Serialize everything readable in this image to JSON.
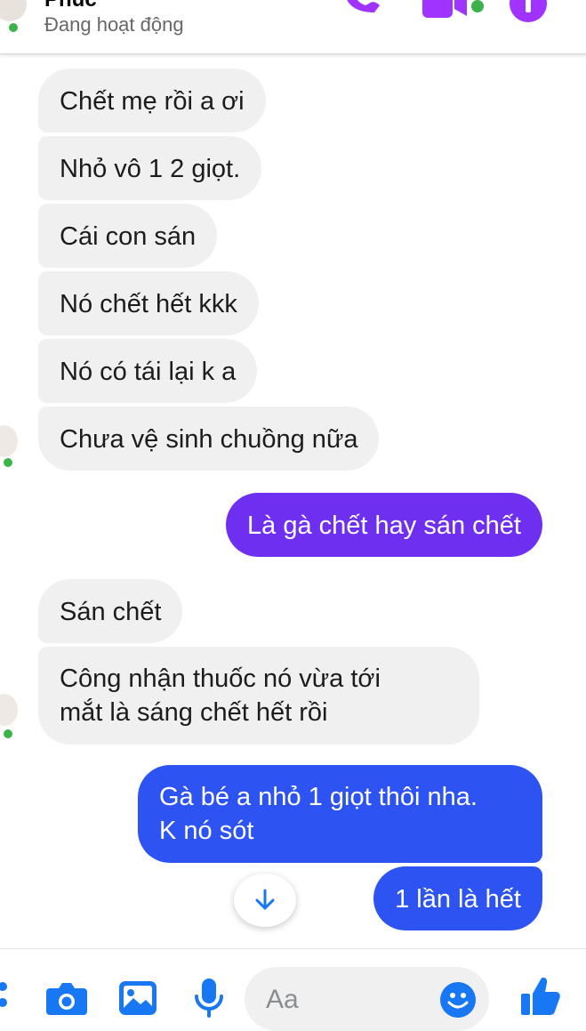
{
  "header": {
    "name": "Phúc",
    "status": "Đang hoạt động",
    "icons": [
      "phone-icon",
      "video-icon",
      "info-icon"
    ],
    "accent_color": "#a033ff"
  },
  "messages": [
    {
      "from": "contact",
      "text": "Chết mẹ rồi a ơi"
    },
    {
      "from": "contact",
      "text": "Nhỏ vô 1 2 giọt."
    },
    {
      "from": "contact",
      "text": "Cái con sán"
    },
    {
      "from": "contact",
      "text": "Nó chết hết kkk"
    },
    {
      "from": "contact",
      "text": "Nó có tái lại k a"
    },
    {
      "from": "contact",
      "text": "Chưa vệ sinh chuồng nữa"
    },
    {
      "from": "me",
      "text": "Là gà chết hay sán chết"
    },
    {
      "from": "contact",
      "text": "Sán chết"
    },
    {
      "from": "contact",
      "lines": [
        "Công nhận thuốc nó vừa tới",
        "mắt là sáng chết hết rồi"
      ]
    },
    {
      "from": "me",
      "lines": [
        "Gà bé a nhỏ 1 giọt thôi nha.",
        "K nó sót"
      ]
    },
    {
      "from": "me",
      "text": "1 lần là hết"
    }
  ],
  "colors": {
    "sent_purple": "#6f2ff0",
    "sent_blue": "#2d54f2",
    "received_bg": "#f0f0f1",
    "icon_blue": "#1877f2",
    "online_green": "#3bb34a"
  },
  "composer": {
    "placeholder": "Aa",
    "icons": [
      "more-icon",
      "camera-icon",
      "image-icon",
      "microphone-icon",
      "emoji-icon",
      "thumbs-up-icon"
    ]
  },
  "scroll_button": {
    "icon": "arrow-down-icon"
  }
}
